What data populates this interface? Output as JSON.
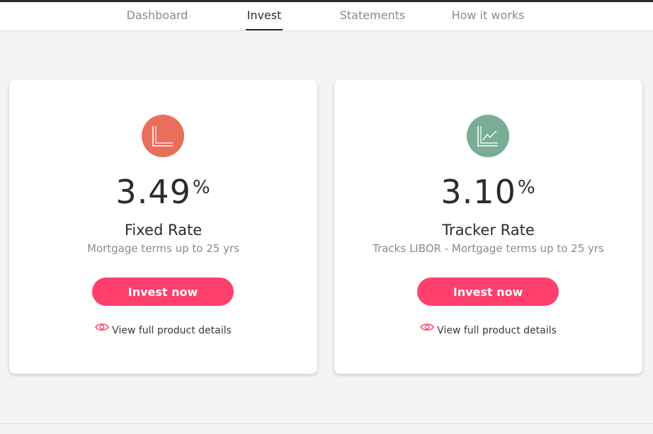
{
  "nav": {
    "tabs": [
      {
        "label": "Dashboard",
        "active": false
      },
      {
        "label": "Invest",
        "active": true
      },
      {
        "label": "Statements",
        "active": false
      },
      {
        "label": "How it works",
        "active": false
      }
    ]
  },
  "products": [
    {
      "icon": "flat-chart-icon",
      "icon_color": "#e96e5b",
      "rate": "3.49",
      "rate_unit": "%",
      "title": "Fixed Rate",
      "subtitle": "Mortgage terms up to 25 yrs",
      "cta_label": "Invest now",
      "details_label": "View full product details"
    },
    {
      "icon": "trend-chart-icon",
      "icon_color": "#79ad98",
      "rate": "3.10",
      "rate_unit": "%",
      "title": "Tracker Rate",
      "subtitle": "Tracks LIBOR - Mortgage terms up to 25 yrs",
      "cta_label": "Invest now",
      "details_label": "View full product details"
    }
  ],
  "colors": {
    "accent": "#fe3f6b",
    "background": "#f4f4f4"
  }
}
